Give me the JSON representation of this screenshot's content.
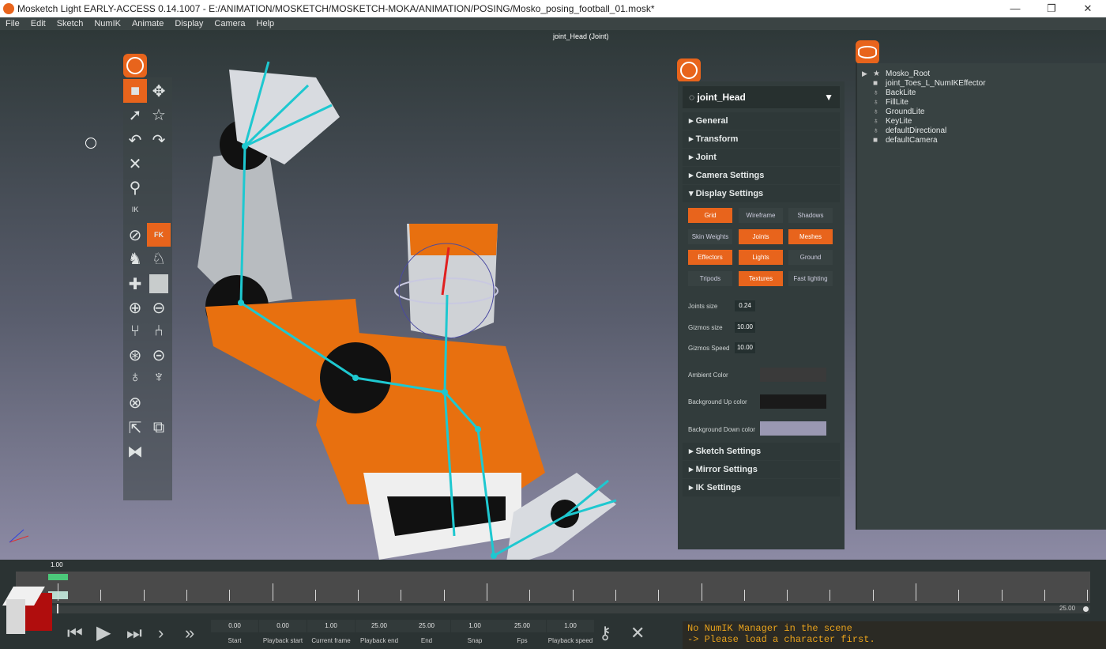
{
  "window": {
    "title": "Mosketch Light EARLY-ACCESS 0.14.1007 - E:/ANIMATION/MOSKETCH/MOSKETCH-MOKA/ANIMATION/POSING/Mosko_posing_football_01.mosk*",
    "minimize": "—",
    "restore": "❐",
    "close": "✕"
  },
  "menu": [
    "File",
    "Edit",
    "Sketch",
    "NumIK",
    "Animate",
    "Display",
    "Camera",
    "Help"
  ],
  "viewport": {
    "title": "joint_Head (Joint)"
  },
  "toolbar": {
    "icons": [
      "camera-icon",
      "move-icon",
      "select-icon",
      "star-icon",
      "undo-icon",
      "redo-icon",
      "delete-icon",
      "zoom-icon",
      "ik-icon",
      "sphere-icon",
      "fk-icon",
      "pose-icon",
      "pose2-icon",
      "add-icon",
      "square-icon",
      "add-joint-icon",
      "remove-joint-icon",
      "branch-icon",
      "branch2-icon",
      "capture-icon",
      "minus-icon",
      "lock-icon",
      "lock2-icon",
      "globe-icon",
      "export-icon",
      "copy-icon",
      "mirror-icon"
    ],
    "fk_label": "FK",
    "ik_label": "IK"
  },
  "properties": {
    "selected": "joint_Head",
    "sections": [
      "General",
      "Transform",
      "Joint",
      "Camera Settings",
      "Display Settings",
      "Sketch Settings",
      "Mirror Settings",
      "IK Settings"
    ],
    "display_buttons": [
      {
        "label": "Grid",
        "on": true
      },
      {
        "label": "Wireframe",
        "on": false
      },
      {
        "label": "Shadows",
        "on": false
      },
      {
        "label": "Skin Weights",
        "on": false
      },
      {
        "label": "Joints",
        "on": true
      },
      {
        "label": "Meshes",
        "on": true
      },
      {
        "label": "Effectors",
        "on": true
      },
      {
        "label": "Lights",
        "on": true
      },
      {
        "label": "Ground",
        "on": false
      },
      {
        "label": "Tripods",
        "on": false
      },
      {
        "label": "Textures",
        "on": true
      },
      {
        "label": "Fast lighting",
        "on": false
      }
    ],
    "joints_size_label": "Joints size",
    "joints_size": "0.24",
    "gizmos_size_label": "Gizmos size",
    "gizmos_size": "10.00",
    "gizmos_speed_label": "Gizmos Speed",
    "gizmos_speed": "10.00",
    "ambient_label": "Ambient Color",
    "ambient_color": "#3a3a3a",
    "bg_up_label": "Background Up color",
    "bg_up_color": "#1a1a1a",
    "bg_down_label": "Background Down color",
    "bg_down_color": "#9a98b2"
  },
  "outliner": {
    "items": [
      {
        "label": "Mosko_Root",
        "icon": "star-icon"
      },
      {
        "label": "joint_Toes_L_NumIKEffector",
        "icon": "square-icon"
      },
      {
        "label": "BackLite",
        "icon": "light-icon"
      },
      {
        "label": "FillLite",
        "icon": "light-icon"
      },
      {
        "label": "GroundLite",
        "icon": "light-icon"
      },
      {
        "label": "KeyLite",
        "icon": "light-icon"
      },
      {
        "label": "defaultDirectional",
        "icon": "light-icon"
      },
      {
        "label": "defaultCamera",
        "icon": "camera-icon"
      }
    ]
  },
  "timeline": {
    "current_marker": "1.00",
    "end_marker": "25.00",
    "fields": [
      {
        "label": "Start",
        "value": "0.00"
      },
      {
        "label": "Playback start",
        "value": "0.00"
      },
      {
        "label": "Current frame",
        "value": "1.00"
      },
      {
        "label": "Playback end",
        "value": "25.00"
      },
      {
        "label": "End",
        "value": "25.00"
      },
      {
        "label": "Snap",
        "value": "1.00"
      },
      {
        "label": "Fps",
        "value": "25.00"
      },
      {
        "label": "Playback speed",
        "value": "1.00"
      }
    ],
    "position_fraction": 0.04
  },
  "console": {
    "line1": "No NumIK Manager in the scene",
    "line2": "-> Please load a character first."
  },
  "accent_color": "#e8641c"
}
